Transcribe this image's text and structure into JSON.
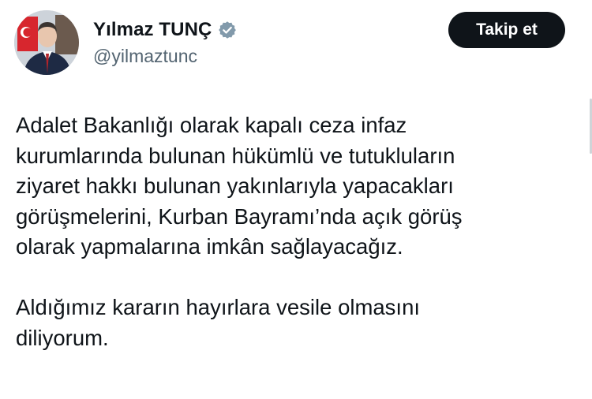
{
  "author": {
    "display_name": "Yılmaz TUNÇ",
    "handle": "@yilmaztunc",
    "verified": true,
    "verified_icon": "verified-badge-icon",
    "avatar_icon": "profile-photo"
  },
  "actions": {
    "follow_label": "Takip et"
  },
  "tweet": {
    "paragraph1": [
      "Adalet Bakanlığı olarak kapalı ceza infaz",
      "kurumlarında bulunan hükümlü ve tutukluların",
      "ziyaret hakkı bulunan yakınlarıyla yapacakları",
      "görüşmelerini, Kurban Bayramı’nda açık görüş",
      "olarak yapmalarına imkân sağlayacağız."
    ],
    "paragraph2": [
      "Aldığımız kararın hayırlara vesile olmasını",
      "diliyorum."
    ]
  },
  "colors": {
    "text": "#0f1419",
    "secondary_text": "#536471",
    "button_bg": "#0f1419",
    "button_text": "#ffffff",
    "verified_badge": "#829aab"
  }
}
